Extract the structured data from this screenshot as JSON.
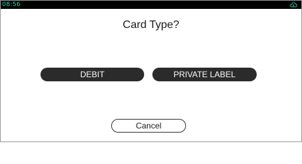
{
  "status_bar": {
    "time": "08:56",
    "status_icon": "cloud-upload-icon",
    "time_color": "#2fd0b0"
  },
  "dialog": {
    "title": "Card Type?",
    "options": [
      {
        "label": "DEBIT"
      },
      {
        "label": "PRIVATE LABEL"
      }
    ],
    "cancel_label": "Cancel"
  }
}
